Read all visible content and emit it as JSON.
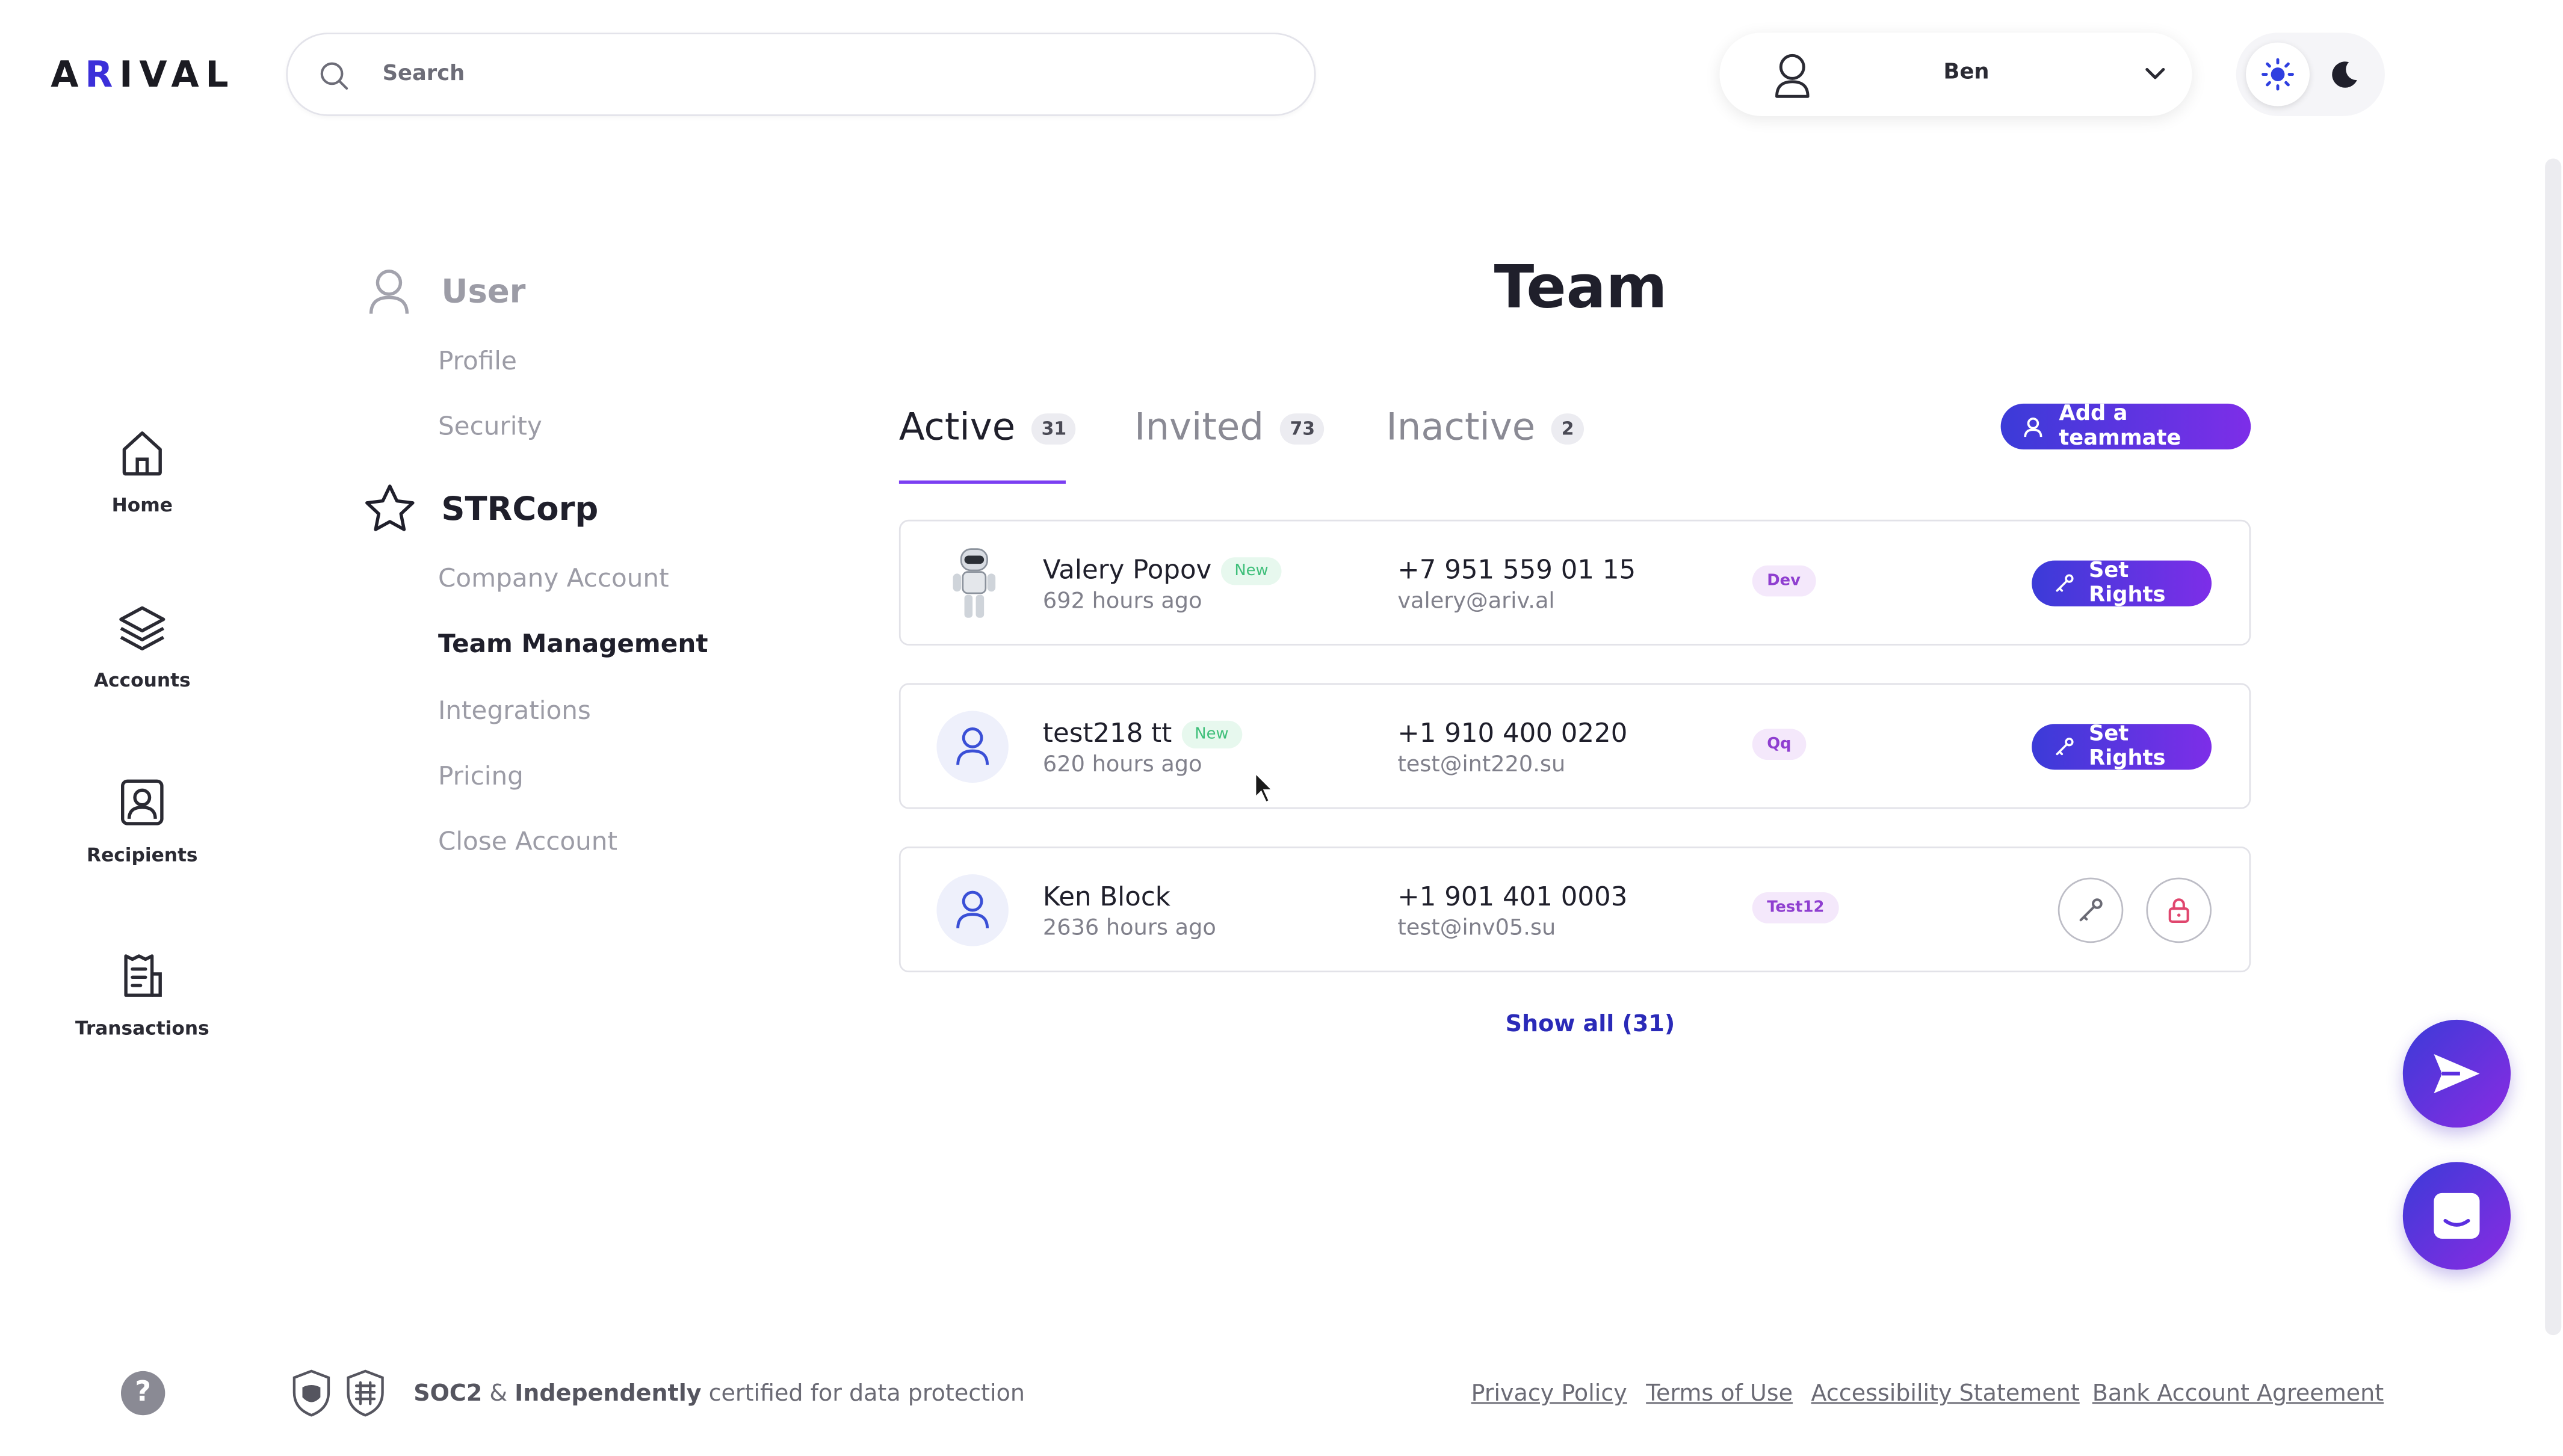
{
  "header": {
    "logo": "ARIVAL",
    "search_placeholder": "Search",
    "user_name": "Ben"
  },
  "nav": {
    "home": "Home",
    "accounts": "Accounts",
    "recipients": "Recipients",
    "transactions": "Transactions"
  },
  "settings": {
    "user_heading": "User",
    "profile": "Profile",
    "security": "Security",
    "company_heading": "STRCorp",
    "company_account": "Company Account",
    "team_management": "Team Management",
    "integrations": "Integrations",
    "pricing": "Pricing",
    "close_account": "Close Account"
  },
  "team": {
    "title": "Team",
    "tabs": [
      {
        "label": "Active",
        "count": "31"
      },
      {
        "label": "Invited",
        "count": "73"
      },
      {
        "label": "Inactive",
        "count": "2"
      }
    ],
    "add_button": "Add a teammate",
    "members": [
      {
        "name": "Valery Popov",
        "badge": "New",
        "time": "692 hours ago",
        "phone": "+7 951 559 01 15",
        "email": "valery@ariv.al",
        "role": "Dev",
        "action": "Set Rights"
      },
      {
        "name": "test218 tt",
        "badge": "New",
        "time": "620 hours ago",
        "phone": "+1 910 400 0220",
        "email": "test@int220.su",
        "role": "Qq",
        "action": "Set Rights"
      },
      {
        "name": "Ken Block",
        "time": "2636 hours ago",
        "phone": "+1 901 401 0003",
        "email": "test@inv05.su",
        "role": "Test12"
      }
    ],
    "show_all": "Show all (31)"
  },
  "footer": {
    "cert_soc2": "SOC2",
    "cert_amp": " & ",
    "cert_ind": "Independently",
    "cert_rest": " certified for data protection",
    "privacy": "Privacy Policy",
    "terms": "Terms of Use",
    "accessibility": "Accessibility Statement",
    "bank": "Bank Account Agreement",
    "help": "?"
  },
  "colors": {
    "accent": "#3b3bd8",
    "accent_end": "#7d2ee8",
    "new_badge": "#3fbf7a",
    "role_badge": "#8f3fd0"
  }
}
